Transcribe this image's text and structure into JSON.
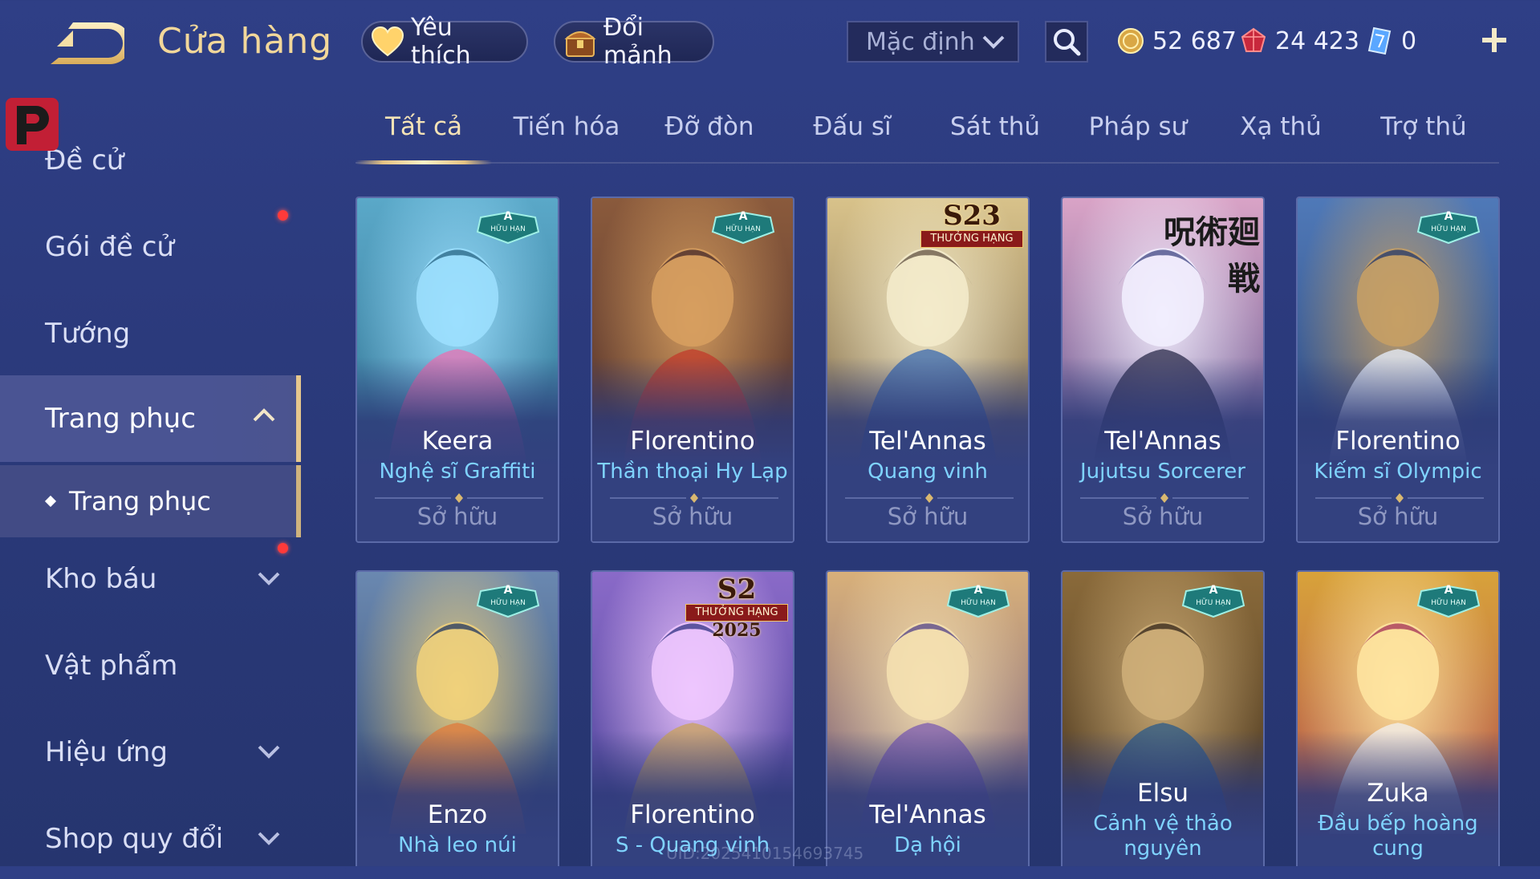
{
  "header": {
    "title": "Cửa hàng",
    "favorites_label": "Yêu thích",
    "exchange_label": "Đổi mảnh",
    "sort": {
      "selected": "Mặc định"
    },
    "currency": {
      "gold": "52 687",
      "ruby": "24 423",
      "token": "0"
    }
  },
  "sidebar": {
    "items": [
      {
        "label": "Đề cử"
      },
      {
        "label": "Gói đề cử"
      },
      {
        "label": "Tướng"
      },
      {
        "label": "Trang phục"
      },
      {
        "label": "Trang phục"
      },
      {
        "label": "Kho báu"
      },
      {
        "label": "Vật phẩm"
      },
      {
        "label": "Hiệu ứng"
      },
      {
        "label": "Shop quy đổi"
      }
    ]
  },
  "tabs": [
    {
      "label": "Tất cả"
    },
    {
      "label": "Tiến hóa"
    },
    {
      "label": "Đỡ đòn"
    },
    {
      "label": "Đấu sĩ"
    },
    {
      "label": "Sát thủ"
    },
    {
      "label": "Pháp sư"
    },
    {
      "label": "Xạ thủ"
    },
    {
      "label": "Trợ thủ"
    }
  ],
  "badges": {
    "limited_grade": "A",
    "limited_text": "HỮU HẠN",
    "s23_title": "S23",
    "s23_text": "THƯỞNG HẠNG",
    "s2_title": "S2",
    "s2_text": "THƯỞNG HẠNG",
    "s2_year": "2025",
    "jjk_logo": "呪術廻戦"
  },
  "cards": [
    {
      "hero": "Keera",
      "skin": "Nghệ sĩ Graffiti",
      "status": "Sở hữu",
      "badge": "limited"
    },
    {
      "hero": "Florentino",
      "skin": "Thần thoại Hy Lạp",
      "status": "Sở hữu",
      "badge": "limited"
    },
    {
      "hero": "Tel'Annas",
      "skin": "Quang vinh",
      "status": "Sở hữu",
      "badge": "season23"
    },
    {
      "hero": "Tel'Annas",
      "skin": "Jujutsu Sorcerer",
      "status": "Sở hữu",
      "badge": "jjk"
    },
    {
      "hero": "Florentino",
      "skin": "Kiếm sĩ Olympic",
      "status": "Sở hữu",
      "badge": "limited"
    },
    {
      "hero": "Enzo",
      "skin": "Nhà leo núi",
      "badge": "limited"
    },
    {
      "hero": "Florentino",
      "skin": "S - Quang vinh",
      "badge": "season2"
    },
    {
      "hero": "Tel'Annas",
      "skin": "Dạ hội",
      "badge": "limited"
    },
    {
      "hero": "Elsu",
      "skin": "Cảnh vệ thảo nguyên",
      "badge": "limited"
    },
    {
      "hero": "Zuka",
      "skin": "Đầu bếp hoàng cung",
      "badge": "limited"
    }
  ],
  "uid_watermark": "UID:2025410154693745",
  "colors": {
    "accent_gold": "#f2d79a",
    "skin_name_blue": "#7fd3ff",
    "notification_red": "#ff3a3a"
  }
}
